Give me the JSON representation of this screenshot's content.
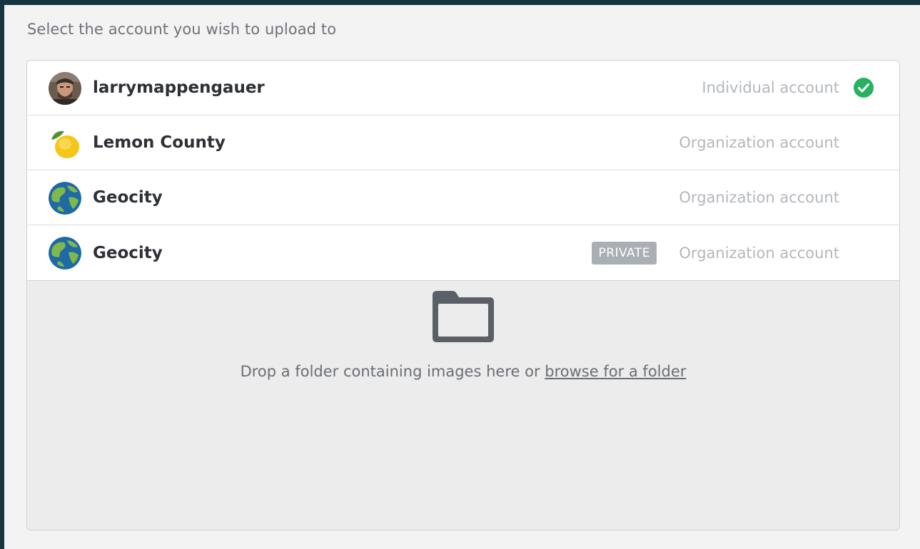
{
  "prompt": "Select the account you wish to upload to",
  "accounts": [
    {
      "name": "larrymappengauer",
      "type": "Individual account",
      "avatar": "user-photo",
      "selected": true,
      "private": false
    },
    {
      "name": "Lemon County",
      "type": "Organization account",
      "avatar": "lemon-logo",
      "selected": false,
      "private": false
    },
    {
      "name": "Geocity",
      "type": "Organization account",
      "avatar": "globe-logo",
      "selected": false,
      "private": false
    },
    {
      "name": "Geocity",
      "type": "Organization account",
      "avatar": "globe-logo",
      "selected": false,
      "private": true,
      "badge": "PRIVATE"
    }
  ],
  "drop_zone": {
    "text": "Drop a folder containing images here or",
    "link": "browse for a folder",
    "icon": "folder-icon"
  },
  "colors": {
    "frame": "#16363f",
    "selected_check": "#27b160",
    "badge": "#a9afb5"
  }
}
